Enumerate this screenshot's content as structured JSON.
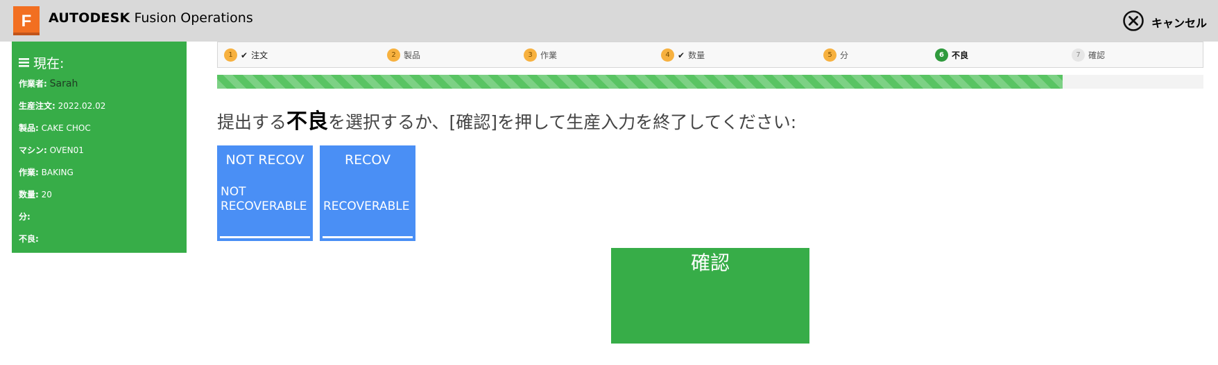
{
  "header": {
    "logo_letter": "F",
    "brand_bold": "AUTODESK",
    "brand_rest": "Fusion Operations",
    "cancel_label": "キャンセル"
  },
  "sidebar": {
    "title": "現在:",
    "rows": [
      {
        "key": "作業者:",
        "value": "Sarah"
      },
      {
        "key": "生産注文:",
        "value": "2022.02.02"
      },
      {
        "key": "製品:",
        "value": "CAKE CHOC"
      },
      {
        "key": "マシン:",
        "value": "OVEN01"
      },
      {
        "key": "作業:",
        "value": "BAKING"
      },
      {
        "key": "数量:",
        "value": "20"
      },
      {
        "key": "分:",
        "value": ""
      },
      {
        "key": "不良:",
        "value": ""
      }
    ]
  },
  "steps": [
    {
      "num": "1",
      "label": "注文",
      "checked": true,
      "state": "done"
    },
    {
      "num": "2",
      "label": "製品",
      "checked": false,
      "state": "done"
    },
    {
      "num": "3",
      "label": "作業",
      "checked": false,
      "state": "done"
    },
    {
      "num": "4",
      "label": "数量",
      "checked": true,
      "state": "done"
    },
    {
      "num": "5",
      "label": "分",
      "checked": false,
      "state": "done"
    },
    {
      "num": "6",
      "label": "不良",
      "checked": false,
      "state": "active"
    },
    {
      "num": "7",
      "label": "確認",
      "checked": false,
      "state": "pending"
    }
  ],
  "progress": {
    "fraction": 0.857
  },
  "instruction": {
    "p1": "提出する",
    "bold": "不良",
    "p2": "を選択するか、[確認]を押して生産入力を終了してください:"
  },
  "options": [
    {
      "code": "NOT RECOV",
      "name": "NOT RECOVERABLE"
    },
    {
      "code": "RECOV",
      "name": "RECOVERABLE"
    }
  ],
  "confirm_label": "確認",
  "colors": {
    "brand_orange": "#f26f21",
    "green": "#37ad48",
    "tile_blue": "#4a8ff5",
    "step_orange": "#f7b13f"
  }
}
